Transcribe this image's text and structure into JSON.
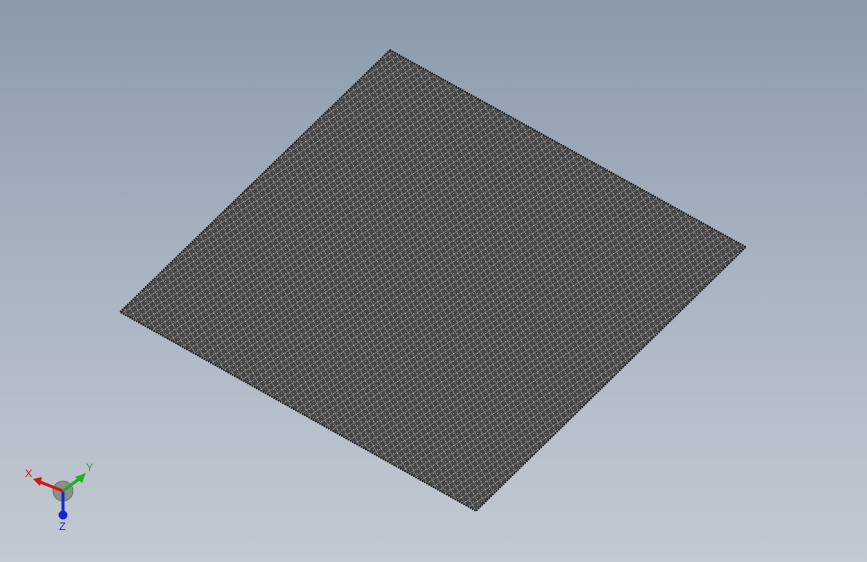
{
  "viewport": {
    "background_top": "#8a9aab",
    "background_bottom": "#c3c9d2"
  },
  "model": {
    "name": "wire-mesh-sheet",
    "fill_color": "#4a4a4a",
    "mesh_color": "#e6e6e6"
  },
  "triad": {
    "x_label": "X",
    "y_label": "Y",
    "z_label": "Z",
    "x_color": "#d21414",
    "y_color": "#19b419",
    "z_color": "#1428d2"
  }
}
